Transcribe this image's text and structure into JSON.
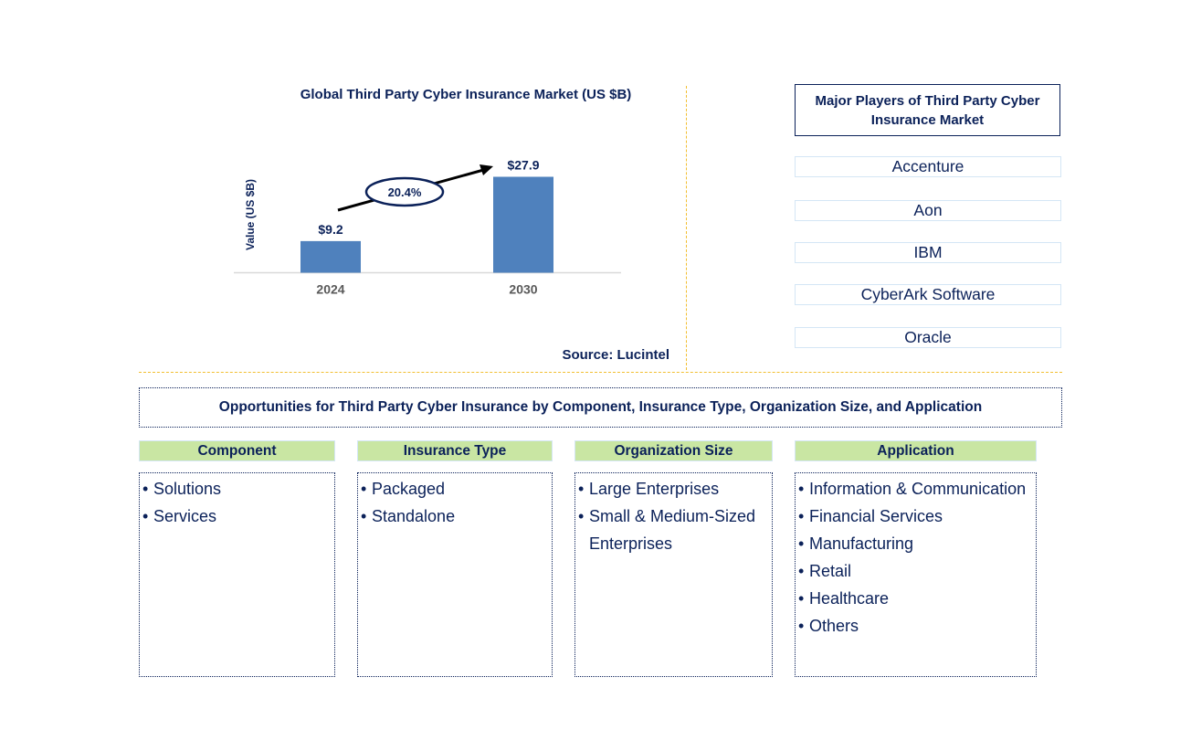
{
  "chart_data": {
    "type": "bar",
    "title": "Global Third Party Cyber Insurance Market (US $B)",
    "xlabel": "",
    "ylabel": "Value (US $B)",
    "categories": [
      "2024",
      "2030"
    ],
    "values": [
      9.2,
      27.9
    ],
    "data_labels": [
      "$9.2",
      "$27.9"
    ],
    "ylim": [
      0,
      30
    ],
    "grid": false,
    "bar_color": "#4f81bd",
    "annotation": {
      "type": "cagr-arrow",
      "label": "20.4%",
      "from": "2024",
      "to": "2030"
    },
    "source": "Source: Lucintel"
  },
  "players": {
    "title": "Major Players of Third Party Cyber Insurance Market",
    "items": [
      "Accenture",
      "Aon",
      "IBM",
      "CyberArk Software",
      "Oracle"
    ]
  },
  "opportunities": {
    "title": "Opportunities for Third Party Cyber Insurance by Component, Insurance Type, Organization Size, and Application",
    "categories": [
      {
        "header": "Component",
        "items": [
          "Solutions",
          "Services"
        ]
      },
      {
        "header": "Insurance Type",
        "items": [
          "Packaged",
          "Standalone"
        ]
      },
      {
        "header": "Organization Size",
        "items": [
          "Large Enterprises",
          "Small & Medium-Sized Enterprises"
        ]
      },
      {
        "header": "Application",
        "items": [
          "Information & Communication",
          "Financial Services",
          "Manufacturing",
          "Retail",
          "Healthcare",
          "Others"
        ]
      }
    ]
  },
  "colors": {
    "text": "#0b2159",
    "bar": "#4f81bd",
    "header_fill": "#c9e6a3",
    "divider": "#f2bf30"
  }
}
